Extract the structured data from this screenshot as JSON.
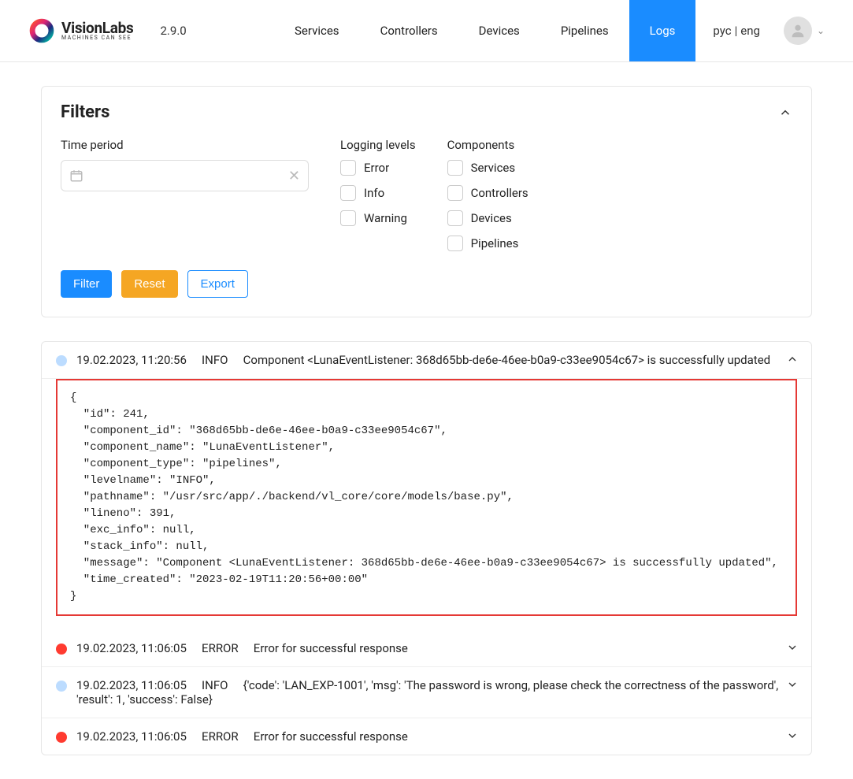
{
  "header": {
    "brand": "VisionLabs",
    "tag": "MACHINES CAN SEE",
    "version": "2.9.0",
    "nav": [
      "Services",
      "Controllers",
      "Devices",
      "Pipelines",
      "Logs"
    ],
    "active_nav": "Logs",
    "lang": {
      "ru": "рус",
      "en": "eng"
    }
  },
  "filters": {
    "title": "Filters",
    "time_label": "Time period",
    "logging_label": "Logging levels",
    "components_label": "Components",
    "levels": [
      "Error",
      "Info",
      "Warning"
    ],
    "components": [
      "Services",
      "Controllers",
      "Devices",
      "Pipelines"
    ],
    "buttons": {
      "filter": "Filter",
      "reset": "Reset",
      "export": "Export"
    }
  },
  "log_entries": [
    {
      "level": "INFO",
      "dot": "info",
      "ts": "19.02.2023, 11:20:56",
      "msg": "Component <LunaEventListener: 368d65bb-de6e-46ee-b0a9-c33ee9054c67> is successfully updated",
      "expanded": true,
      "detail": "{\n  \"id\": 241,\n  \"component_id\": \"368d65bb-de6e-46ee-b0a9-c33ee9054c67\",\n  \"component_name\": \"LunaEventListener\",\n  \"component_type\": \"pipelines\",\n  \"levelname\": \"INFO\",\n  \"pathname\": \"/usr/src/app/./backend/vl_core/core/models/base.py\",\n  \"lineno\": 391,\n  \"exc_info\": null,\n  \"stack_info\": null,\n  \"message\": \"Component <LunaEventListener: 368d65bb-de6e-46ee-b0a9-c33ee9054c67> is successfully updated\",\n  \"time_created\": \"2023-02-19T11:20:56+00:00\"\n}"
    },
    {
      "level": "ERROR",
      "dot": "error",
      "ts": "19.02.2023, 11:06:05",
      "msg": "Error for successful response",
      "expanded": false
    },
    {
      "level": "INFO",
      "dot": "info",
      "ts": "19.02.2023, 11:06:05",
      "msg": "{'code': 'LAN_EXP-1001', 'msg': 'The password is wrong, please check the correctness of the password', 'result': 1, 'success': False}",
      "expanded": false
    },
    {
      "level": "ERROR",
      "dot": "error",
      "ts": "19.02.2023, 11:06:05",
      "msg": "Error for successful response",
      "expanded": false
    }
  ]
}
